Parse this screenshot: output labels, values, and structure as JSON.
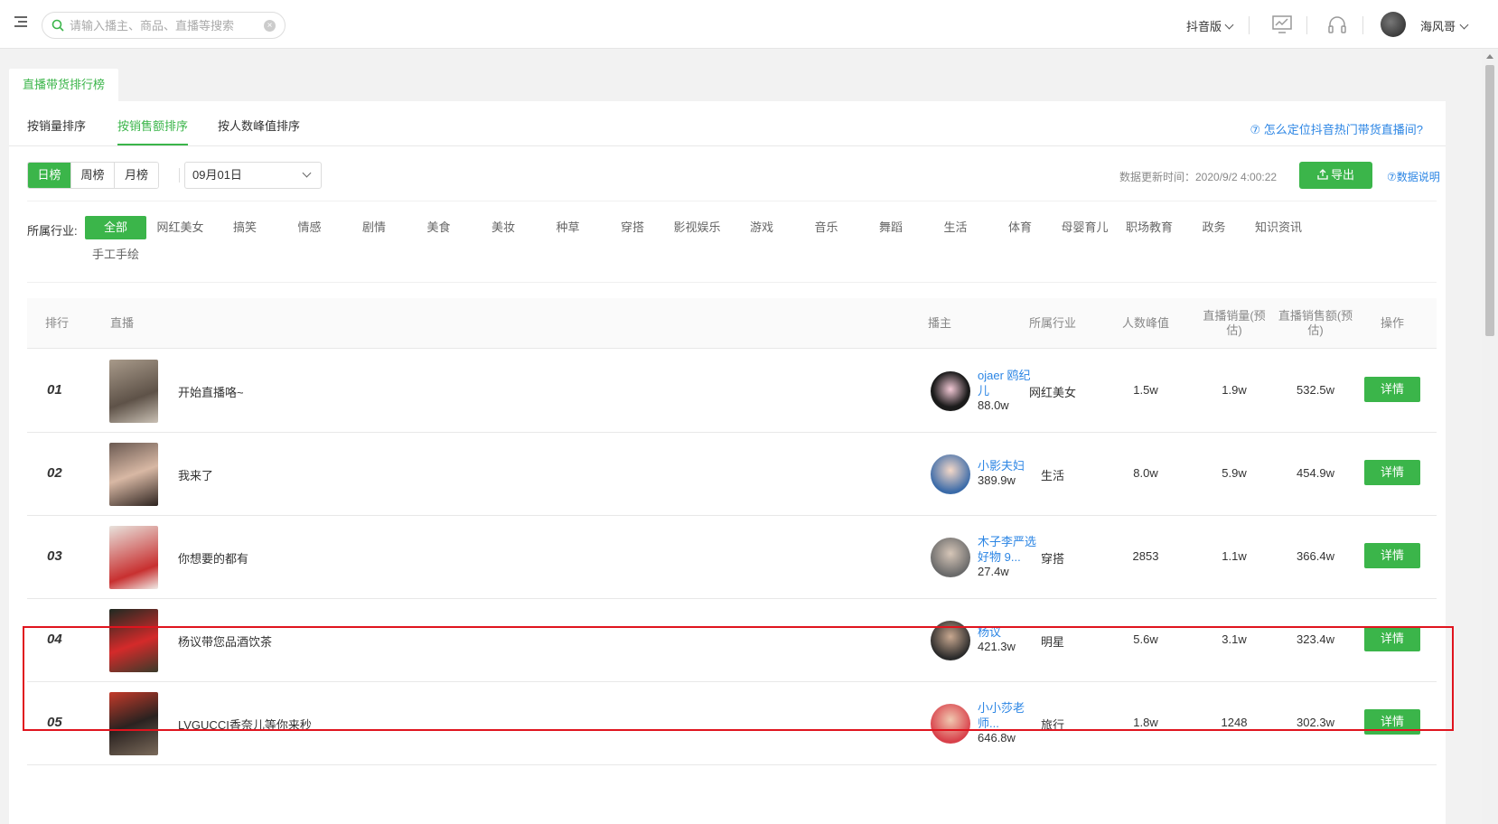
{
  "header": {
    "search_placeholder": "请输入播主、商品、直播等搜索",
    "version_label": "抖音版",
    "username": "海风哥"
  },
  "page_tab": "直播带货排行榜",
  "sort_tabs": [
    "按销量排序",
    "按销售额排序",
    "按人数峰值排序"
  ],
  "help_link": "⑦ 怎么定位抖音热门带货直播间?",
  "period_buttons": [
    "日榜",
    "周榜",
    "月榜"
  ],
  "date_value": "09月01日",
  "update_time": "数据更新时间：2020/9/2 4:00:22",
  "export_label": "导出",
  "data_note": "⑦数据说明",
  "industry_label": "所属行业:",
  "industries": [
    "全部",
    "网红美女",
    "搞笑",
    "情感",
    "剧情",
    "美食",
    "美妆",
    "种草",
    "穿搭",
    "影视娱乐",
    "游戏",
    "音乐",
    "舞蹈",
    "生活",
    "体育",
    "母婴育儿",
    "职场教育",
    "政务",
    "知识资讯",
    "手工手绘"
  ],
  "table": {
    "headers": [
      "排行",
      "直播",
      "播主",
      "所属行业",
      "人数峰值",
      "直播销量(预估)",
      "直播销售额(预估)",
      "操作"
    ],
    "detail_label": "详情",
    "rows": [
      {
        "rank": "01",
        "title": "开始直播咯~",
        "host": "ojaer 鸥纪儿",
        "fans": "88.0w",
        "industry": "网红美女",
        "peak": "1.5w",
        "sales": "1.9w",
        "amount": "532.5w"
      },
      {
        "rank": "02",
        "title": "我来了",
        "host": "小影夫妇",
        "fans": "389.9w",
        "industry": "生活",
        "peak": "8.0w",
        "sales": "5.9w",
        "amount": "454.9w"
      },
      {
        "rank": "03",
        "title": "你想要的都有",
        "host": "木子李严选好物 9...",
        "fans": "27.4w",
        "industry": "穿搭",
        "peak": "2853",
        "sales": "1.1w",
        "amount": "366.4w"
      },
      {
        "rank": "04",
        "title": "杨议带您品酒饮茶",
        "host": "杨议",
        "fans": "421.3w",
        "industry": "明星",
        "peak": "5.6w",
        "sales": "3.1w",
        "amount": "323.4w"
      },
      {
        "rank": "05",
        "title": "LVGUCCI香奈儿等你来秒",
        "host": "小小莎老师...",
        "fans": "646.8w",
        "industry": "旅行",
        "peak": "1.8w",
        "sales": "1248",
        "amount": "302.3w"
      }
    ]
  },
  "colors": {
    "accent": "#3bb54a",
    "link": "#2b85e4",
    "highlight": "#e0141e"
  }
}
